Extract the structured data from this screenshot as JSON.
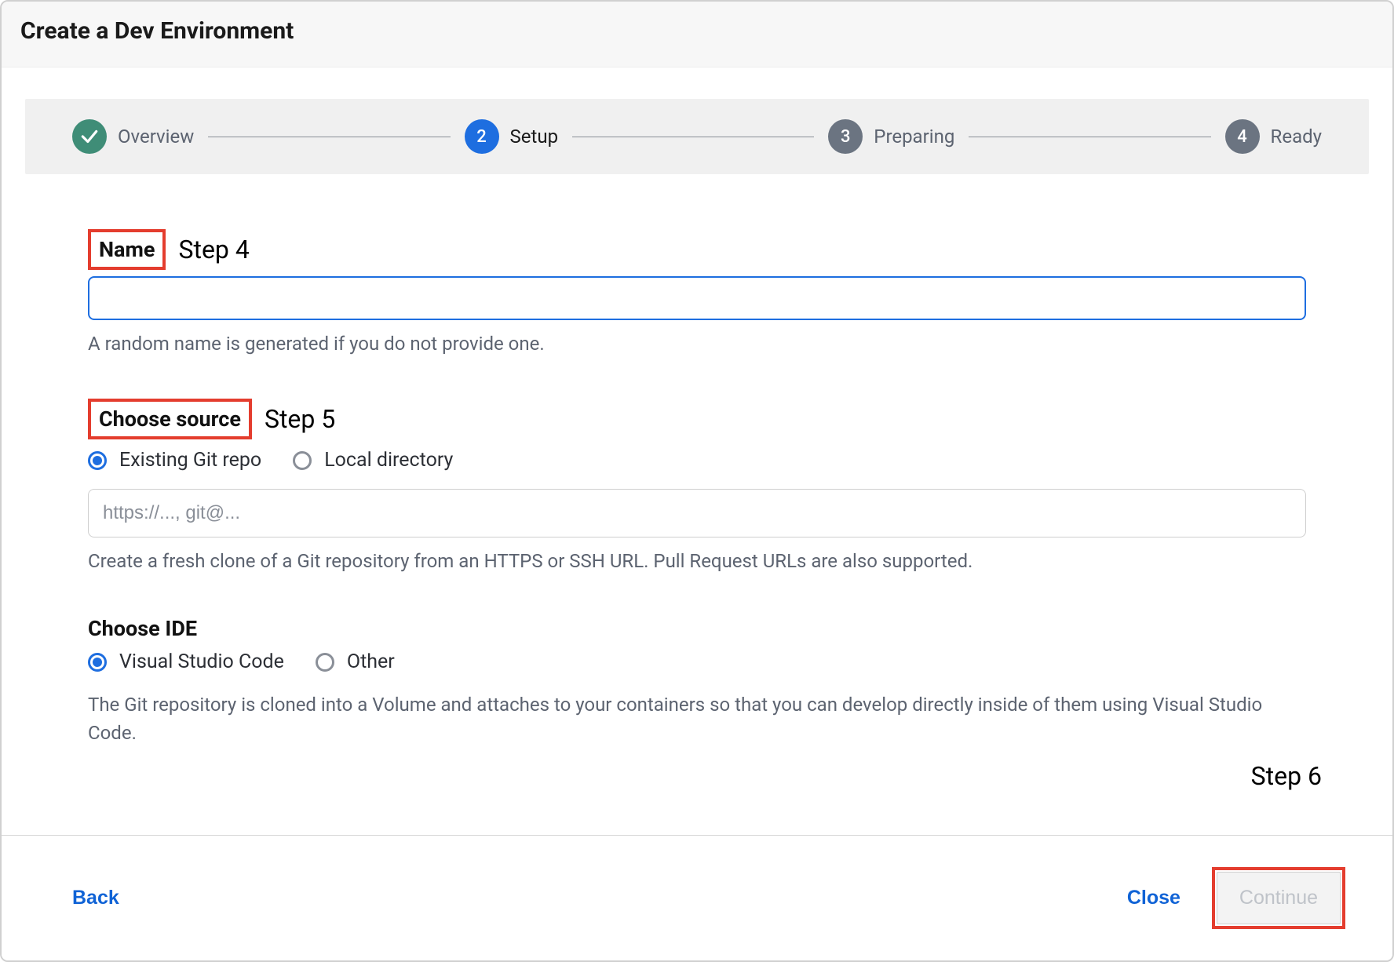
{
  "dialog": {
    "title": "Create a Dev Environment"
  },
  "stepper": {
    "steps": [
      {
        "num": "",
        "label": "Overview",
        "state": "done"
      },
      {
        "num": "2",
        "label": "Setup",
        "state": "active"
      },
      {
        "num": "3",
        "label": "Preparing",
        "state": "pending"
      },
      {
        "num": "4",
        "label": "Ready",
        "state": "pending"
      }
    ]
  },
  "annotations": {
    "step4": "Step 4",
    "step5": "Step 5",
    "step6": "Step 6"
  },
  "form": {
    "name": {
      "label": "Name",
      "value": "",
      "helper": "A random name is generated if you do not provide one."
    },
    "source": {
      "label": "Choose source",
      "options": [
        {
          "label": "Existing Git repo",
          "checked": true
        },
        {
          "label": "Local directory",
          "checked": false
        }
      ],
      "url_placeholder": "https://..., git@...",
      "url_value": "",
      "helper": "Create a fresh clone of a Git repository from an HTTPS or SSH URL. Pull Request URLs are also supported."
    },
    "ide": {
      "label": "Choose IDE",
      "options": [
        {
          "label": "Visual Studio Code",
          "checked": true
        },
        {
          "label": "Other",
          "checked": false
        }
      ],
      "helper": "The Git repository is cloned into a Volume and attaches to your containers so that you can develop directly inside of them using Visual Studio Code."
    }
  },
  "footer": {
    "back": "Back",
    "close": "Close",
    "continue": "Continue"
  }
}
